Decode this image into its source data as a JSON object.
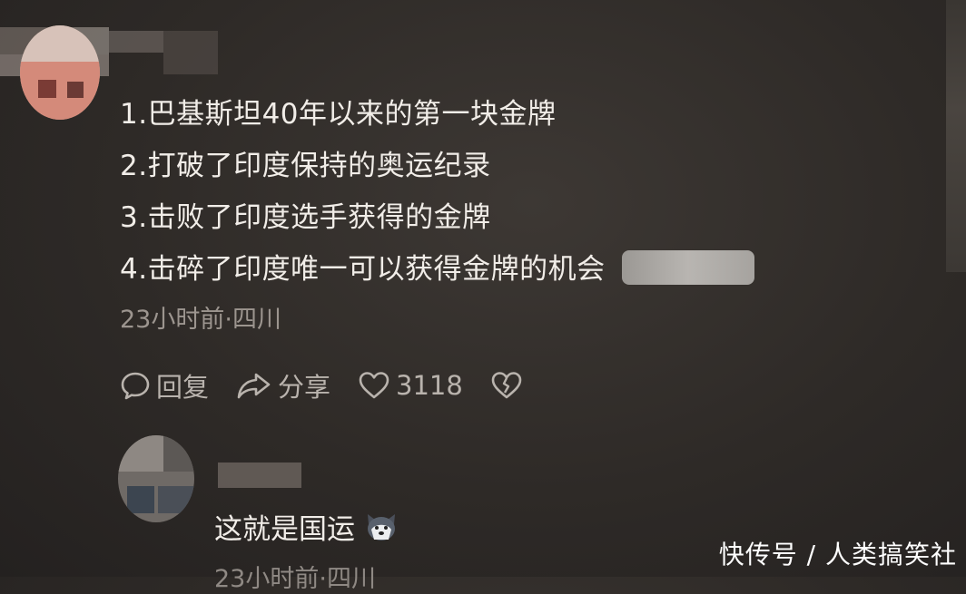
{
  "comment": {
    "lines": [
      "1.巴基斯坦40年以来的第一块金牌",
      "2.打破了印度保持的奥运纪录",
      "3.击败了印度选手获得的金牌",
      "4.击碎了印度唯一可以获得金牌的机会"
    ],
    "meta": "23小时前·四川",
    "actions": {
      "reply_label": "回复",
      "share_label": "分享",
      "like_count": "3118"
    }
  },
  "reply": {
    "text": "这就是国运",
    "meta": "23小时前·四川",
    "emoji_icon": "husky-dog-emoji-icon"
  },
  "watermark": "快传号 / 人类搞笑社",
  "colors": {
    "background": "#2e2a27",
    "text_primary": "#f1ede8",
    "text_secondary": "#9c958f"
  }
}
